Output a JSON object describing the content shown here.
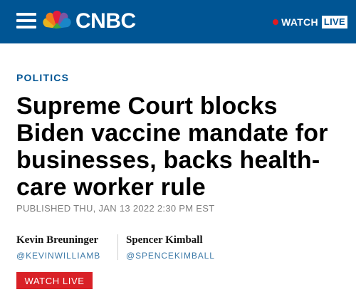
{
  "header": {
    "logo_text": "CNBC",
    "watch_label": "WATCH",
    "live_label": "LIVE",
    "icons": [
      "menu-icon",
      "nbc-peacock-logo",
      "live-dot-icon"
    ],
    "background_color": "#005594"
  },
  "article": {
    "section": "POLITICS",
    "headline": "Supreme Court blocks Biden vaccine mandate for businesses, backs health-care worker rule",
    "published": "PUBLISHED THU, JAN 13 2022 2:30 PM EST",
    "authors": [
      {
        "name": "Kevin Breuninger",
        "handle": "@KEVINWILLIAMB"
      },
      {
        "name": "Spencer Kimball",
        "handle": "@SPENCEKIMBALL"
      }
    ],
    "watch_button_label": "WATCH LIVE",
    "accent_color": "#d92127"
  }
}
